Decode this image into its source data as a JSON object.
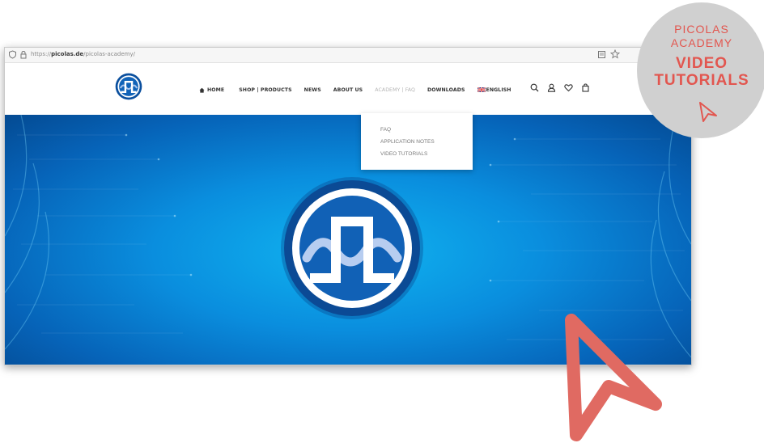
{
  "browser": {
    "url_prefix": "https://",
    "url_domain": "picolas.de",
    "url_path": "/picolas-academy/"
  },
  "nav": {
    "items": [
      {
        "label": "HOME",
        "icon": "home-icon"
      },
      {
        "label": "SHOP | PRODUCTS"
      },
      {
        "label": "NEWS"
      },
      {
        "label": "ABOUT US"
      },
      {
        "label": "ACADEMY | FAQ",
        "active": true
      },
      {
        "label": "DOWNLOADS"
      },
      {
        "label": "ENGLISH",
        "icon": "uk-flag-icon"
      }
    ],
    "icons": [
      "search-icon",
      "user-icon",
      "heart-icon",
      "bag-icon"
    ]
  },
  "dropdown": {
    "items": [
      "FAQ",
      "APPLICATION NOTES",
      "VIDEO TUTORIALS"
    ]
  },
  "badge": {
    "line1": "PICOLAS",
    "line2": "ACADEMY",
    "line3": "VIDEO",
    "line4": "TUTORIALS"
  },
  "colors": {
    "accent": "#e2564f",
    "brand_blue": "#0a6fc4",
    "hero_light": "#10b4f0"
  }
}
